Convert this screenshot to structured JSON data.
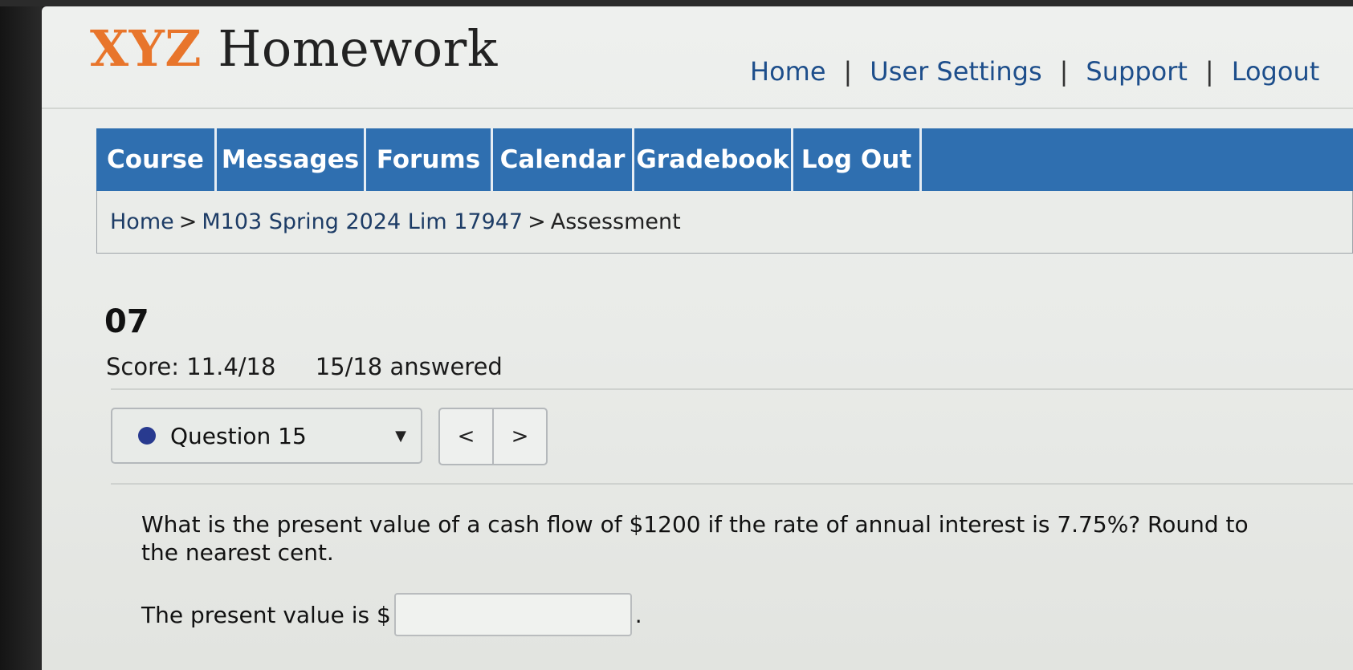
{
  "header": {
    "logo_part1": "XYZ",
    "logo_part2": "Homework",
    "links": [
      "Home",
      "User Settings",
      "Support",
      "Logout"
    ],
    "separator": "|"
  },
  "nav": {
    "tabs": [
      "Course",
      "Messages",
      "Forums",
      "Calendar",
      "Gradebook",
      "Log Out"
    ]
  },
  "breadcrumb": {
    "items": [
      "Home",
      "M103 Spring 2024 Lim 17947",
      "Assessment"
    ],
    "separator": ">"
  },
  "assessment": {
    "title": "07",
    "score": "Score: 11.4/18",
    "answered": "15/18 answered"
  },
  "question_nav": {
    "selected": "Question 15",
    "prev_label": "<",
    "next_label": ">"
  },
  "question": {
    "text": "What is the present value of a cash flow of $1200 if the rate of annual interest is 7.75%? Round to the nearest cent.",
    "answer_prefix": "The present value is $",
    "answer_value": "",
    "answer_suffix": "."
  },
  "colors": {
    "logo_accent": "#e8752b",
    "nav_background": "#2f6fb0",
    "link": "#1d4e8b",
    "status_dot": "#283a8f"
  },
  "icons": {
    "status": "status-dot-icon",
    "dropdown": "chevron-down-icon",
    "prev": "chevron-left-icon",
    "next": "chevron-right-icon"
  }
}
